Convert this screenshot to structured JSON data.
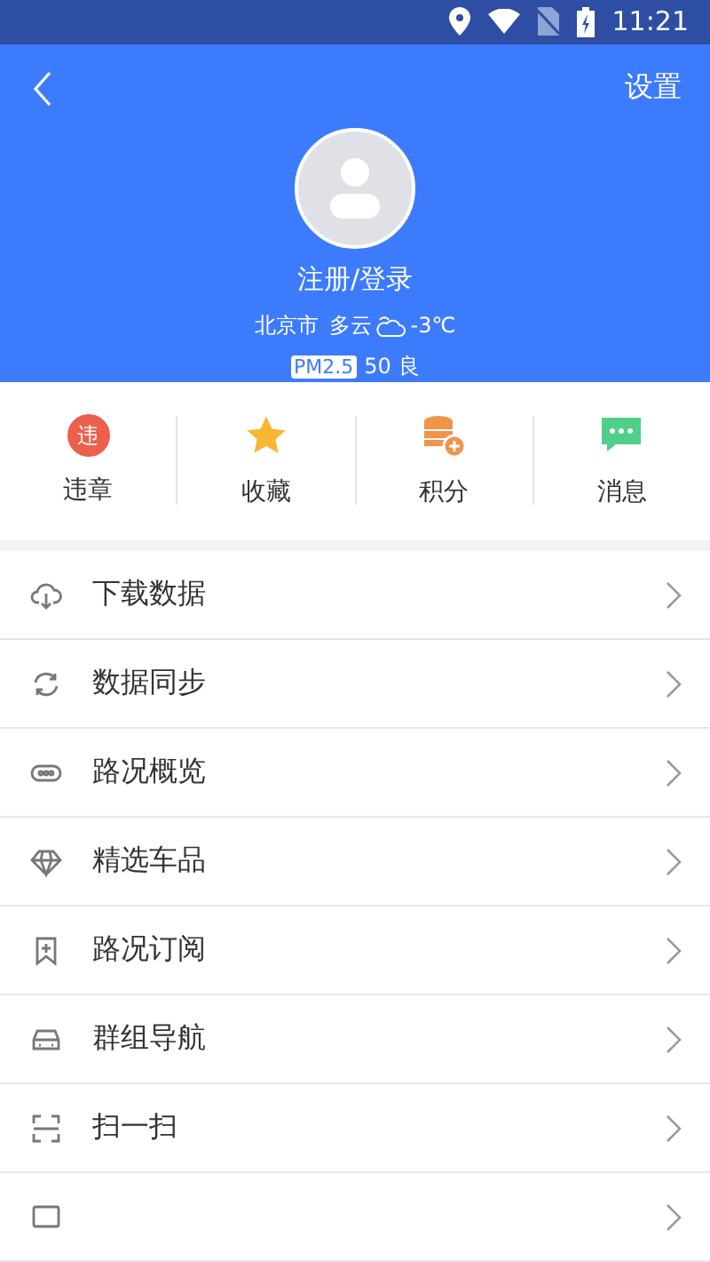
{
  "status_bar": {
    "time": "11:21"
  },
  "header": {
    "settings": "设置",
    "login": "注册/登录",
    "city": "北京市",
    "weather": "多云",
    "temperature": "-3℃",
    "aqi_tag": "PM2.5",
    "aqi_value": "50",
    "aqi_level": "良"
  },
  "shortcuts": [
    {
      "kind": "violation",
      "glyph": "违",
      "label": "违章"
    },
    {
      "kind": "star",
      "label": "收藏"
    },
    {
      "kind": "coins",
      "label": "积分"
    },
    {
      "kind": "message",
      "label": "消息"
    }
  ],
  "menu": [
    {
      "kind": "download",
      "label": "下载数据"
    },
    {
      "kind": "sync",
      "label": "数据同步"
    },
    {
      "kind": "traffic",
      "label": "路况概览"
    },
    {
      "kind": "diamond",
      "label": "精选车品"
    },
    {
      "kind": "subscribe",
      "label": "路况订阅"
    },
    {
      "kind": "car",
      "label": "群组导航"
    },
    {
      "kind": "scan",
      "label": "扫一扫"
    },
    {
      "kind": "partial"
    }
  ]
}
